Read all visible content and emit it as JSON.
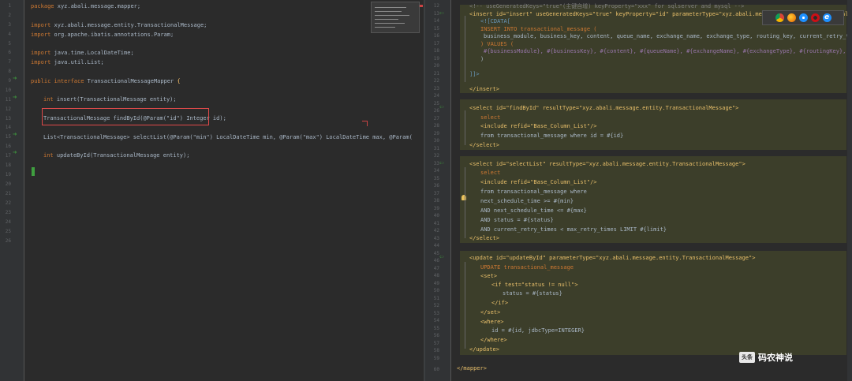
{
  "left_editor": {
    "gutter_lines": [
      "1",
      "2",
      "3",
      "4",
      "5",
      "6",
      "7",
      "8",
      "9",
      "10",
      "11",
      "12",
      "13",
      "14",
      "15",
      "16",
      "17",
      "18",
      "19",
      "20",
      "21",
      "22",
      "23",
      "24",
      "25",
      "26"
    ],
    "code": [
      {
        "kw": "package",
        "rest": " xyz.abali.message.mapper;"
      },
      {
        "kw": "import",
        "rest": " xyz.abali.message.entity.TransactionalMessage;"
      },
      {
        "kw": "import",
        "rest": " org.apache.ibatis.annotations.Param;"
      },
      {
        "kw": "import",
        "rest": " java.time.LocalDateTime;"
      },
      {
        "kw": "import",
        "rest": " java.util.List;"
      },
      {
        "kw": "public interface",
        "rest": " TransactionalMessageMapper "
      },
      {
        "kw": "int",
        "rest": " insert(TransactionalMessage entity);"
      },
      {
        "kw": "",
        "rest": "TransactionalMessage findById(@Param(\"id\") Integer id);"
      },
      {
        "kw": "",
        "rest": "List<TransactionalMessage> selectList(@Param(\"min\") LocalDateTime min, @Param(\"max\") LocalDateTime max, @Param("
      },
      {
        "kw": "int",
        "rest": " updateById(TransactionalMessage entity);"
      },
      {
        "kw": "",
        "rest": "}"
      }
    ]
  },
  "right_editor": {
    "gutter_lines": [
      "12",
      "13",
      "14",
      "15",
      "16",
      "17",
      "18",
      "19",
      "20",
      "21",
      "22",
      "23",
      "24",
      "25",
      "26",
      "27",
      "28",
      "29",
      "30",
      "31",
      "32",
      "33",
      "34",
      "35",
      "36",
      "37",
      "38",
      "39",
      "40",
      "41",
      "42",
      "43",
      "44",
      "45",
      "46",
      "47",
      "48",
      "49",
      "50",
      "51",
      "52",
      "53",
      "54",
      "55",
      "56",
      "57",
      "58",
      "59",
      "60"
    ],
    "code": [
      "<!-- useGeneratedKeys=\"true\"(主键自增) keyProperty=\"xxx\" for sqlserver and mysql -->",
      "<insert id=\"insert\" useGeneratedKeys=\"true\" keyProperty=\"id\" parameterType=\"xyz.abali.message.entity.TransactionalMessage\">",
      "<![CDATA[",
      "INSERT INTO transactional_message (",
      "business_module, business_key, content, queue_name, exchange_name, exchange_type, routing_key, current_retry_times, max_retry_",
      ") VALUES (",
      "#{businessModule}, #{businessKey}, #{content}, #{queueName}, #{exchangeName}, #{exchangeType}, #{routingKey}, #{currentRetryTi",
      ")",
      "]]>",
      "</insert>",
      "<select id=\"findById\" resultType=\"xyz.abali.message.entity.TransactionalMessage\">",
      "select",
      "<include refid=\"Base_Column_List\"/>",
      "from transactional_message where id = #{id}",
      "</select>",
      "<select id=\"selectList\" resultType=\"xyz.abali.message.entity.TransactionalMessage\">",
      "select",
      "<include refid=\"Base_Column_List\"/>",
      "from transactional_message where",
      "next_schedule_time >= #{min}",
      "AND next_schedule_time <= #{max}",
      "AND status = #{status}",
      "AND current_retry_times < max_retry_times LIMIT #{limit}",
      "</select>",
      "<update id=\"updateById\" parameterType=\"xyz.abali.message.entity.TransactionalMessage\">",
      "UPDATE transactional_message",
      "<set>",
      "<if test=\"status != null\">",
      "status = #{status}",
      "</if>",
      "</set>",
      "<where>",
      "id = #{id, jdbcType=INTEGER}",
      "</where>",
      "</update>",
      "</mapper>"
    ]
  },
  "watermark": {
    "logo_text": "头条",
    "text": "码农神说"
  },
  "colors": {
    "background": "#2b2b2b",
    "keyword": "#cc7832",
    "string": "#6a8759",
    "annotation": "#bbb529",
    "tag": "#e8bf6a",
    "highlight_box": "#e04a4a"
  },
  "icons": [
    "implement-arrow-icon",
    "goto-arrow-icon",
    "bulb-icon",
    "chrome-icon",
    "firefox-icon",
    "safari-icon",
    "opera-icon",
    "ie-icon"
  ]
}
